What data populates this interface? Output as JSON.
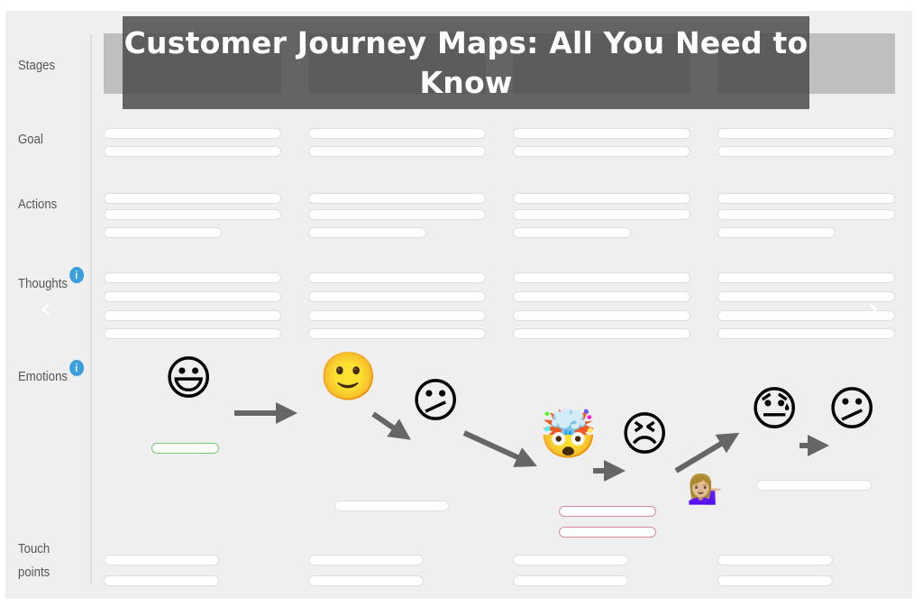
{
  "title": "Customer Journey Maps: All You Need to Know",
  "row_labels": {
    "stages": "Stages",
    "goal": "Goal",
    "actions": "Actions",
    "thoughts": "Thoughts",
    "emotions": "Emotions",
    "touch": "Touch",
    "points": "points"
  },
  "info_icon": "i",
  "nav": {
    "prev": "‹",
    "next": "›"
  },
  "stages_count": 4,
  "emotions": [
    {
      "name": "grinning-face",
      "glyph": "😃"
    },
    {
      "name": "slightly-smiling-face",
      "glyph": "🙂"
    },
    {
      "name": "confused-face",
      "glyph": "😕"
    },
    {
      "name": "exploding-head",
      "glyph": "🤯"
    },
    {
      "name": "persevering-face",
      "glyph": "😣"
    },
    {
      "name": "downcast-sweat-face",
      "glyph": "😓"
    },
    {
      "name": "confused-face-2",
      "glyph": "😕"
    },
    {
      "name": "person-tipping-hand",
      "glyph": "💁🏼‍♀️"
    }
  ],
  "colors": {
    "positive": "#7ac77a",
    "negative": "#d98b9a",
    "info": "#3a9fe0",
    "arrow": "#666666"
  }
}
